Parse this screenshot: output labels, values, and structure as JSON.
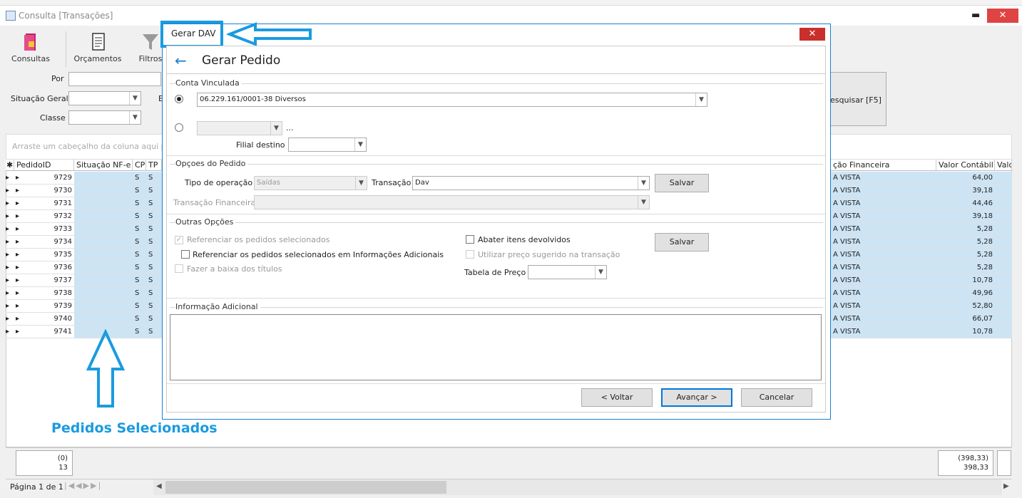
{
  "window": {
    "title": "Consulta [Transações]",
    "min_glyph": "▬",
    "close_glyph": "✕"
  },
  "toolbar": {
    "consultas": "Consultas",
    "orcamentos": "Orçamentos",
    "filtros": "Filtros"
  },
  "filters": {
    "por_label": "Por",
    "situacao_label": "Situação Geral",
    "classe_label": "Classe",
    "partial_label": "E",
    "pesquisar": "esquisar [F5]"
  },
  "group_hint": "Arraste um cabeçalho da coluna aqui par",
  "grid": {
    "headers": [
      "PedidoID",
      "Situação NF-e",
      "CP",
      "TP",
      "ção Financeira",
      "Valor Contábil",
      "Valo"
    ],
    "rows": [
      {
        "id": "9729",
        "cp": "S",
        "tp": "S",
        "fin": "A VISTA",
        "valor": "64,00"
      },
      {
        "id": "9730",
        "cp": "S",
        "tp": "S",
        "fin": "A VISTA",
        "valor": "39,18"
      },
      {
        "id": "9731",
        "cp": "S",
        "tp": "S",
        "fin": "A VISTA",
        "valor": "44,46"
      },
      {
        "id": "9732",
        "cp": "S",
        "tp": "S",
        "fin": "A VISTA",
        "valor": "39,18"
      },
      {
        "id": "9733",
        "cp": "S",
        "tp": "S",
        "fin": "A VISTA",
        "valor": "5,28"
      },
      {
        "id": "9734",
        "cp": "S",
        "tp": "S",
        "fin": "A VISTA",
        "valor": "5,28"
      },
      {
        "id": "9735",
        "cp": "S",
        "tp": "S",
        "fin": "A VISTA",
        "valor": "5,28"
      },
      {
        "id": "9736",
        "cp": "S",
        "tp": "S",
        "fin": "A VISTA",
        "valor": "5,28"
      },
      {
        "id": "9737",
        "cp": "S",
        "tp": "S",
        "fin": "A VISTA",
        "valor": "10,78"
      },
      {
        "id": "9738",
        "cp": "S",
        "tp": "S",
        "fin": "A VISTA",
        "valor": "49,96"
      },
      {
        "id": "9739",
        "cp": "S",
        "tp": "S",
        "fin": "A VISTA",
        "valor": "52,80"
      },
      {
        "id": "9740",
        "cp": "S",
        "tp": "S",
        "fin": "A VISTA",
        "valor": "66,07"
      },
      {
        "id": "9741",
        "cp": "S",
        "tp": "S",
        "fin": "A VISTA",
        "valor": "10,78"
      }
    ]
  },
  "footer": {
    "count_line1": "(0)",
    "count_line2": "13",
    "sum_line1": "(398,33)",
    "sum_line2": "398,33",
    "pager": "Página 1 de 1"
  },
  "annotation": {
    "pedidos_selecionados": "Pedidos Selecionados",
    "accent": "#1a9be0"
  },
  "dialog": {
    "title": "Gerar DAV",
    "close_glyph": "✕",
    "heading": "Gerar Pedido",
    "conta": {
      "group": "Conta Vinculada",
      "account_value": "06.229.161/0001-38 Diversos",
      "ellipsis": "...",
      "filial_label": "Filial destino"
    },
    "opcoes": {
      "group": "Opçoes do Pedido",
      "tipo_label": "Tipo de operação",
      "tipo_value": "Saídas",
      "transacao_label": "Transação",
      "transacao_value": "Dav",
      "salvar": "Salvar",
      "trans_fin_label": "Transação Financeira"
    },
    "outras": {
      "group": "Outras Opções",
      "ref_pedidos": "Referenciar os pedidos selecionados",
      "ref_info": "Referenciar os pedidos selecionados em Informações Adicionais",
      "baixa_titulos": "Fazer a baixa dos títulos",
      "abater": "Abater itens devolvidos",
      "preco_sugerido": "Utilizar preço sugerido na transação",
      "tabela_label": "Tabela de Preço",
      "salvar": "Salvar"
    },
    "info_group": "Informação Adicional",
    "buttons": {
      "voltar": "< Voltar",
      "avancar": "Avançar >",
      "cancelar": "Cancelar"
    }
  }
}
